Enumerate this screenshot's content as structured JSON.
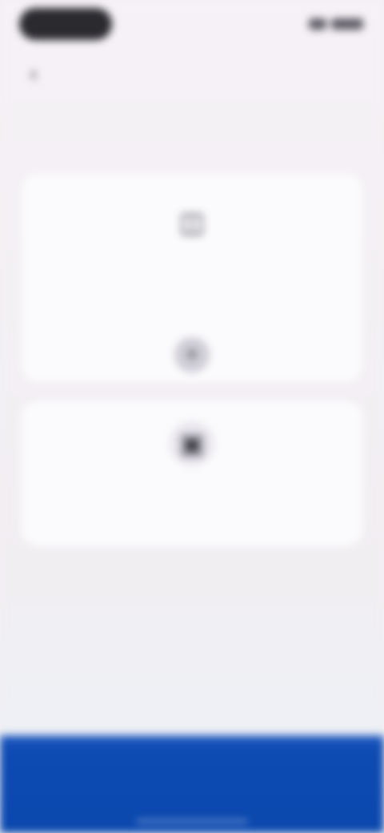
{
  "status_bar": {
    "time": "",
    "icons": [
      "signal-icon",
      "battery-icon"
    ]
  },
  "header": {
    "back_icon": "chevron-left-icon",
    "title": "",
    "action_label": ""
  },
  "subtitle": "",
  "cards": {
    "add": {
      "icon": "card-icon",
      "heading": "",
      "description": "",
      "plus_icon": "plus-icon"
    },
    "scan": {
      "icon": "scan-icon",
      "heading": "",
      "description": ""
    }
  },
  "primary_button": {
    "label": ""
  },
  "colors": {
    "accent": "#0a48ae",
    "background": "#f3f0f4",
    "card": "#fbfafc"
  }
}
